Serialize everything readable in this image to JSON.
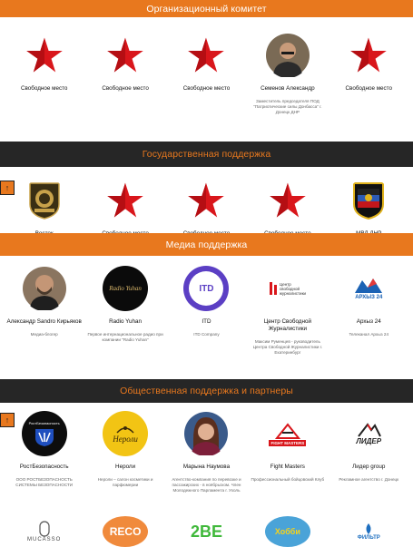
{
  "sections": {
    "org": {
      "title": "Организационный комитет"
    },
    "gov": {
      "title": "Государственная поддержка"
    },
    "media": {
      "title": "Медиа поддержка"
    },
    "public": {
      "title": "Общественная поддержка и партнеры"
    }
  },
  "up_icon": "↑",
  "colors": {
    "accent": "#e8781e",
    "dark": "#262626",
    "star": "#d9161b"
  },
  "org_items": [
    {
      "name": "Свободное место",
      "desc": ""
    },
    {
      "name": "Свободное место",
      "desc": ""
    },
    {
      "name": "Свободное место",
      "desc": ""
    },
    {
      "name": "Семенов Александр",
      "desc": "Заместитель председателя ПОД \"Патриотические силы Донбасса\" г. Донецк ДНР"
    },
    {
      "name": "Свободное место",
      "desc": ""
    }
  ],
  "gov_items": [
    {
      "name": "Восток",
      "icon": "vostok-emblem-icon"
    },
    {
      "name": "Свободное место",
      "icon": "red-star-icon"
    },
    {
      "name": "Свободное место",
      "icon": "red-star-icon"
    },
    {
      "name": "Свободное место",
      "icon": "red-star-icon"
    },
    {
      "name": "МВД ДНР",
      "icon": "mvd-emblem-icon"
    }
  ],
  "media_items": [
    {
      "name": "Александр Sandro Кирьяков",
      "desc": "Медиа-блогер"
    },
    {
      "name": "Radio Yuhan",
      "desc": "Первое интернациональное радио при компании \"Radio Yuhan\"",
      "logo_text": "Radio Yuhan"
    },
    {
      "name": "ITD",
      "desc": "ITD Company",
      "logo_text": "ITD"
    },
    {
      "name": "Центр Свободной Журналистики",
      "desc": "Максим Руменцев - руководитель Центра Свободной Журналистики г. Екатеринбург",
      "logo_text": "Центр свободной журналистики"
    },
    {
      "name": "Архыз 24",
      "desc": "Телеканал Архыз 24",
      "logo_text": "АРХЫЗ 24"
    }
  ],
  "public_items": [
    {
      "name": "РостБезопасность",
      "desc": "ООО РОСТБЕЗОПАСНОСТЬ СИСТЕМЫ БЕЗОПАСНОСТИ",
      "logo_text": "РостБезопасность"
    },
    {
      "name": "Нероли",
      "desc": "Нероли – салон косметики и парфюмерии",
      "logo_text": "Нероли"
    },
    {
      "name": "Марына Наумова",
      "desc": "Агентство-компания по перевозке и пассажирских - в ноябрьском. Член Молодежного Парламента г. Ухоль",
      "logo_text": ""
    },
    {
      "name": "Fight Masters",
      "desc": "Профессиональный бойцовский Клуб",
      "logo_text": "FIGHT MASTERS"
    },
    {
      "name": "Лидер group",
      "desc": "Рекламное агентство г. Донецк",
      "logo_text": "ЛИДЕР"
    }
  ],
  "bottom_items": [
    {
      "logo_text": "MUCASSO"
    },
    {
      "logo_text": "RECO"
    },
    {
      "logo_text": "2BE"
    },
    {
      "logo_text": "Хобби"
    },
    {
      "logo_text": "ФИЛЬТР"
    }
  ]
}
